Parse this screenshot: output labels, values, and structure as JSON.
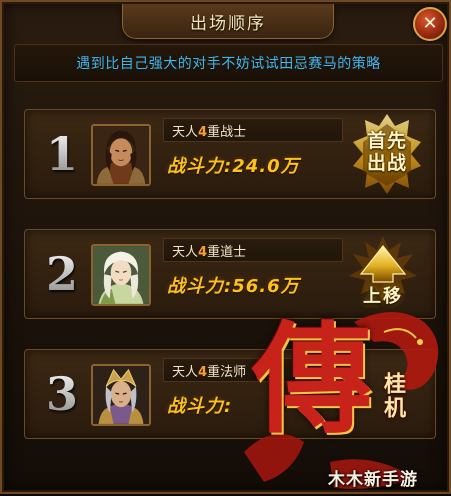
{
  "dialog": {
    "title": "出场顺序",
    "close_icon": "close-icon",
    "hint": "遇到比自己强大的对手不妨试试田忌赛马的策略"
  },
  "slots": [
    {
      "rank": "1",
      "name_prefix": "天人",
      "name_level": "4",
      "name_suffix": "重战士",
      "power": "战斗力:24.0万",
      "action_icon": "first-out-badge-icon",
      "action_label": "首先出战"
    },
    {
      "rank": "2",
      "name_prefix": "天人",
      "name_level": "4",
      "name_suffix": "重道士",
      "power": "战斗力:56.6万",
      "action_icon": "move-up-arrow-icon",
      "action_label": "上移"
    },
    {
      "rank": "3",
      "name_prefix": "天人",
      "name_level": "4",
      "name_suffix": "重法师",
      "power": "战斗力:"
    }
  ],
  "watermark": {
    "logo_big": "傳",
    "logo_small": "桂机",
    "site": "木木新手游"
  },
  "colors": {
    "hint_text": "#3fb6f0",
    "power_text": "#ffc21a",
    "level_number": "#ff9d2a",
    "frame_gold": "#8a6330"
  }
}
